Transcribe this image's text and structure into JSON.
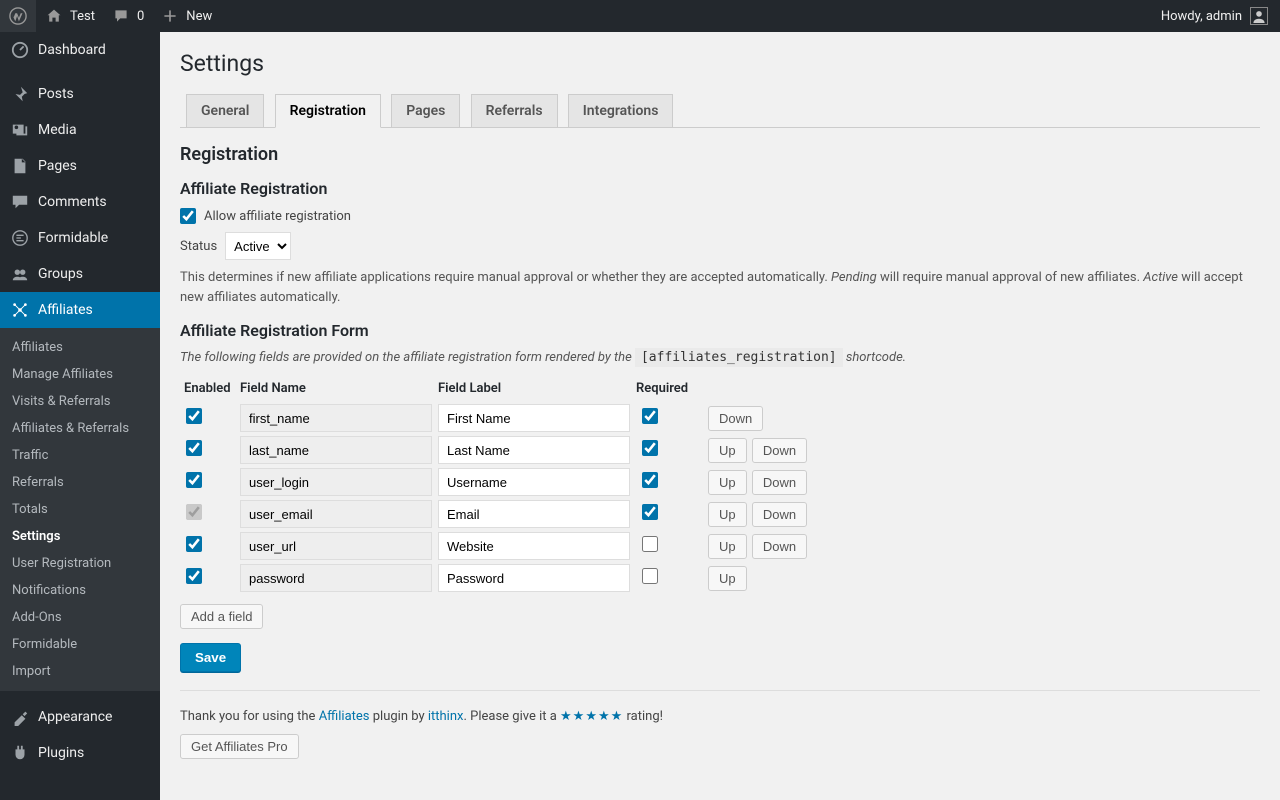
{
  "admin_bar": {
    "site_name": "Test",
    "comments_count": "0",
    "new_label": "New",
    "howdy": "Howdy, admin"
  },
  "sidebar": {
    "items": [
      {
        "label": "Dashboard"
      },
      {
        "label": "Posts"
      },
      {
        "label": "Media"
      },
      {
        "label": "Pages"
      },
      {
        "label": "Comments"
      },
      {
        "label": "Formidable"
      },
      {
        "label": "Groups"
      },
      {
        "label": "Affiliates"
      },
      {
        "label": "Appearance"
      },
      {
        "label": "Plugins"
      }
    ],
    "submenu": [
      {
        "label": "Affiliates"
      },
      {
        "label": "Manage Affiliates"
      },
      {
        "label": "Visits & Referrals"
      },
      {
        "label": "Affiliates & Referrals"
      },
      {
        "label": "Traffic"
      },
      {
        "label": "Referrals"
      },
      {
        "label": "Totals"
      },
      {
        "label": "Settings"
      },
      {
        "label": "User Registration"
      },
      {
        "label": "Notifications"
      },
      {
        "label": "Add-Ons"
      },
      {
        "label": "Formidable"
      },
      {
        "label": "Import"
      }
    ]
  },
  "page": {
    "title": "Settings",
    "tabs": [
      {
        "label": "General"
      },
      {
        "label": "Registration"
      },
      {
        "label": "Pages"
      },
      {
        "label": "Referrals"
      },
      {
        "label": "Integrations"
      }
    ],
    "section_registration": "Registration",
    "section_affiliate_reg": "Affiliate Registration",
    "allow_label": "Allow affiliate registration",
    "status_label": "Status",
    "status_value": "Active",
    "status_desc_pre": "This determines if new affiliate applications require manual approval or whether they are accepted automatically. ",
    "status_desc_pending": "Pending",
    "status_desc_mid": " will require manual approval of new affiliates. ",
    "status_desc_active": "Active",
    "status_desc_post": " will accept new affiliates automatically.",
    "section_form": "Affiliate Registration Form",
    "shortcode_pre": "The following fields are provided on the affiliate registration form rendered by the ",
    "shortcode": "[affiliates_registration]",
    "shortcode_post": " shortcode.",
    "table": {
      "headers": {
        "enabled": "Enabled",
        "name": "Field Name",
        "label": "Field Label",
        "required": "Required"
      },
      "rows": [
        {
          "enabled": true,
          "enabled_disabled": false,
          "name": "first_name",
          "label": "First Name",
          "required": true,
          "up": false,
          "down": true
        },
        {
          "enabled": true,
          "enabled_disabled": false,
          "name": "last_name",
          "label": "Last Name",
          "required": true,
          "up": true,
          "down": true
        },
        {
          "enabled": true,
          "enabled_disabled": false,
          "name": "user_login",
          "label": "Username",
          "required": true,
          "up": true,
          "down": true
        },
        {
          "enabled": true,
          "enabled_disabled": true,
          "name": "user_email",
          "label": "Email",
          "required": true,
          "up": true,
          "down": true
        },
        {
          "enabled": true,
          "enabled_disabled": false,
          "name": "user_url",
          "label": "Website",
          "required": false,
          "up": true,
          "down": true
        },
        {
          "enabled": true,
          "enabled_disabled": false,
          "name": "password",
          "label": "Password",
          "required": false,
          "up": true,
          "down": false
        }
      ]
    },
    "add_field": "Add a field",
    "save": "Save",
    "up": "Up",
    "down": "Down",
    "thanks_pre": "Thank you for using the ",
    "thanks_link": "Affiliates",
    "thanks_mid": " plugin by ",
    "thanks_author": "itthinx",
    "thanks_post": ". Please give it a ",
    "thanks_stars": "★★★★★",
    "thanks_end": " rating!",
    "get_pro": "Get Affiliates Pro"
  }
}
